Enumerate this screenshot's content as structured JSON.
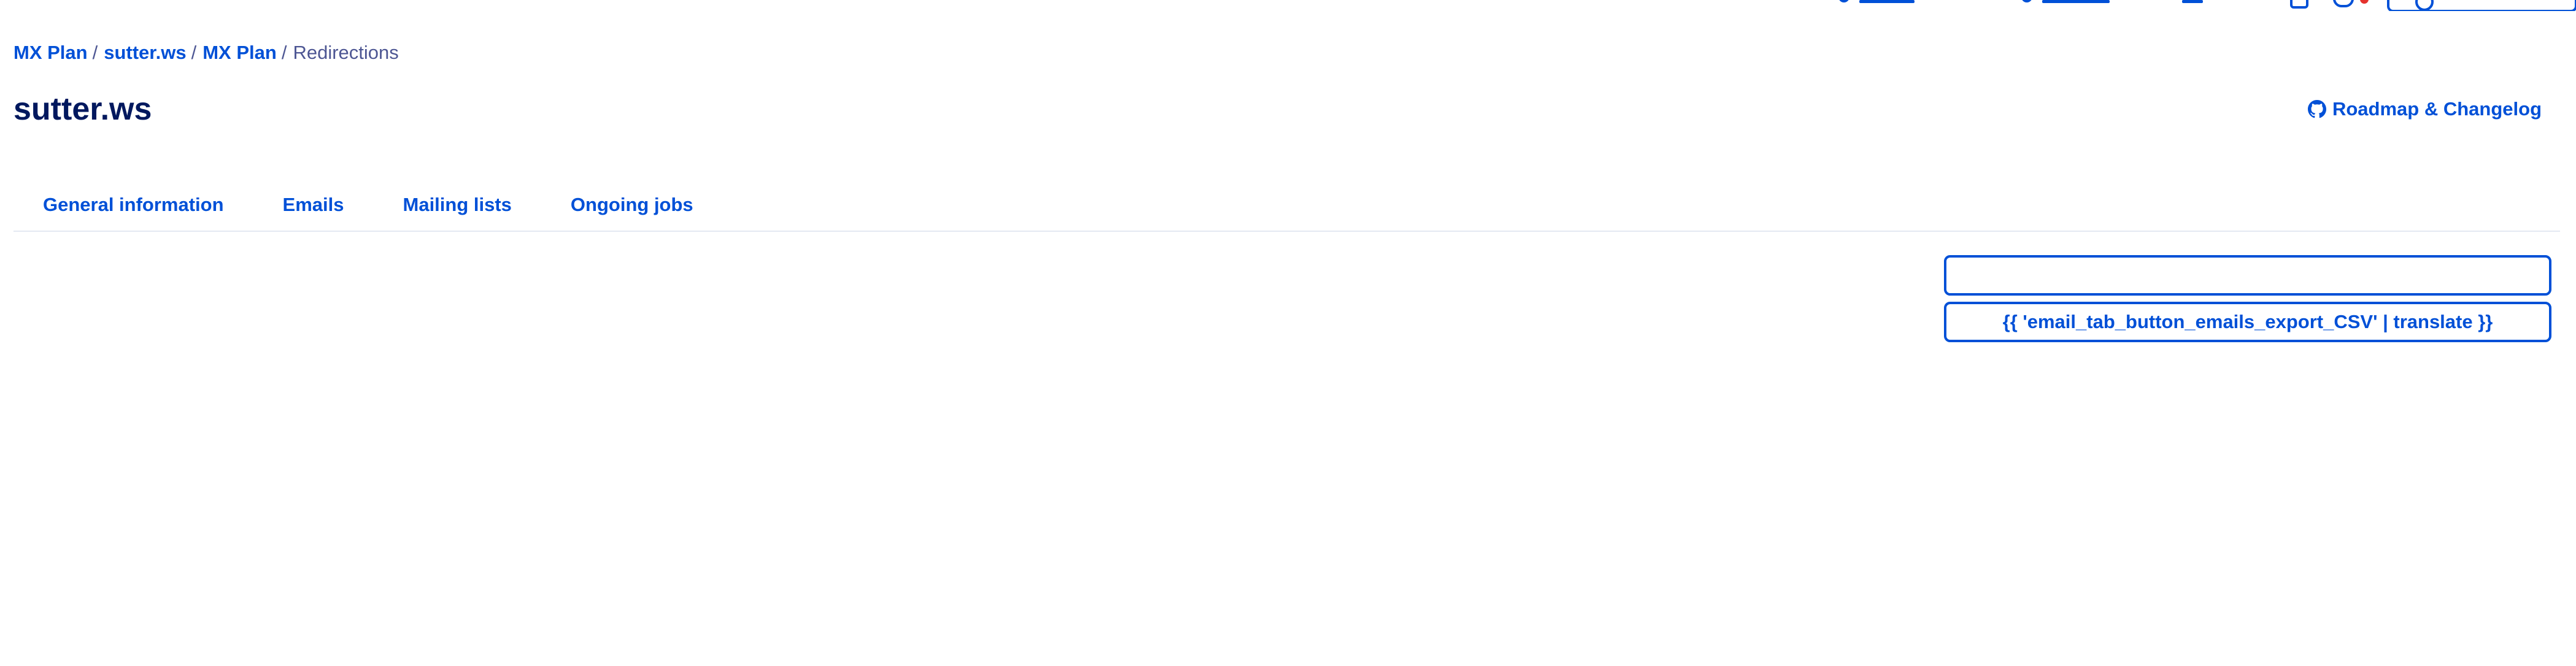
{
  "breadcrumb": {
    "items": [
      {
        "label": "MX Plan"
      },
      {
        "label": "sutter.ws"
      },
      {
        "label": "MX Plan"
      }
    ],
    "separator": "/",
    "current": "Redirections"
  },
  "header": {
    "title": "sutter.ws",
    "roadmap_link": "Roadmap & Changelog"
  },
  "tabs": [
    {
      "label": "General information"
    },
    {
      "label": "Emails"
    },
    {
      "label": "Mailing lists"
    },
    {
      "label": "Ongoing jobs"
    }
  ],
  "actions": {
    "primary_button_label": "",
    "export_button_label": "{{ 'email_tab_button_emails_export_CSV' | translate }}"
  },
  "colors": {
    "accent": "#0050d7",
    "title": "#00185e",
    "muted": "#4d5693",
    "divider": "#e4e9f2",
    "notification_badge": "#e5322d"
  }
}
